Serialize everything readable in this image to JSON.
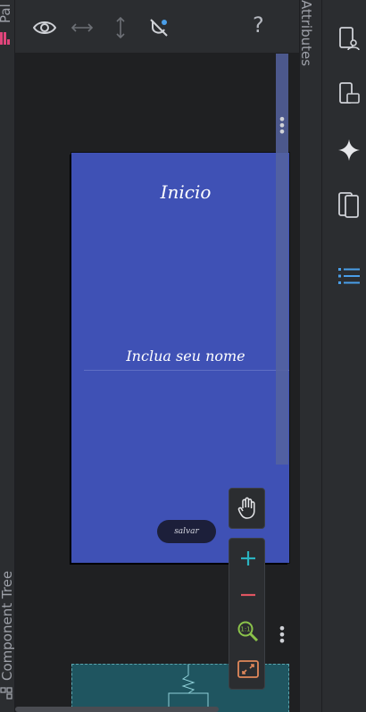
{
  "left_panels": {
    "palette_label": "Pal",
    "component_tree_label": "Component Tree"
  },
  "toolbar": {
    "help_label": "?",
    "icons": [
      "eye-icon",
      "resize-horizontal-icon",
      "resize-vertical-icon",
      "constraints-off-icon"
    ]
  },
  "phone_screen": {
    "title": "Inicio",
    "input_hint": "Inclua seu nome",
    "button_label": "salvar",
    "background_color": "#3f51b5"
  },
  "zoom_controls": {
    "icons": [
      "pan-hand-icon",
      "zoom-in-icon",
      "zoom-out-icon",
      "zoom-to-actual-icon",
      "fit-screen-icon"
    ]
  },
  "attributes_label": "Attributes",
  "right_bar": {
    "icons": [
      "device-manager-icon",
      "running-devices-icon",
      "gemini-icon",
      "device-mirroring-icon",
      "structure-icon"
    ]
  }
}
